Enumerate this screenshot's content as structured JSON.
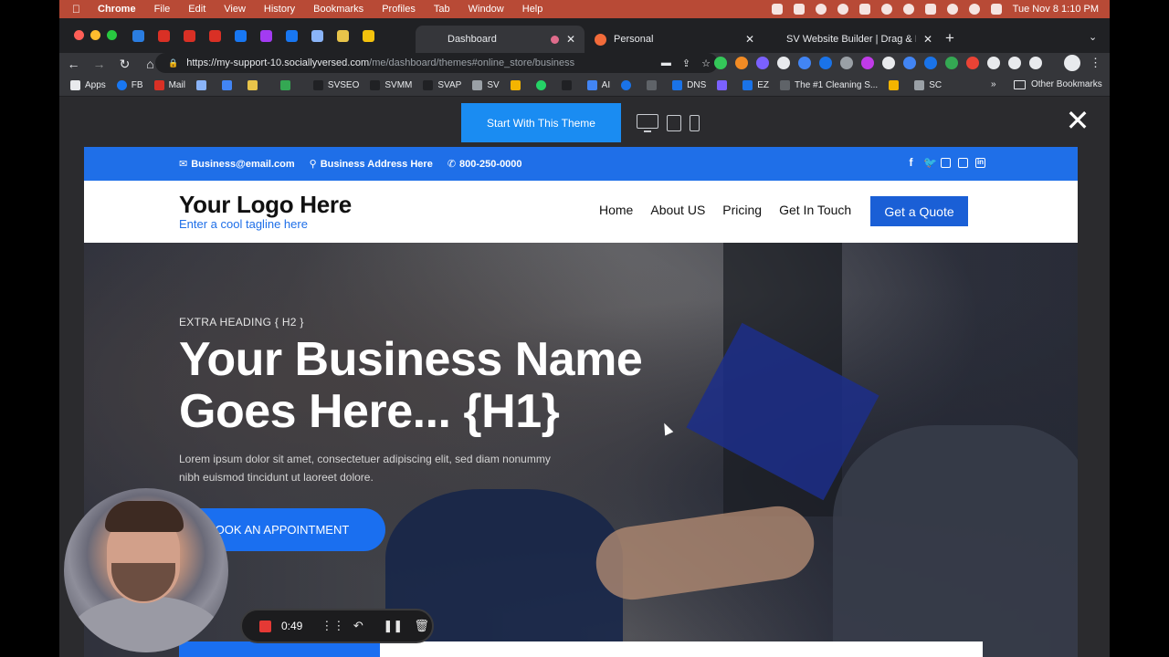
{
  "menubar": {
    "app": "Chrome",
    "items": [
      "File",
      "Edit",
      "View",
      "History",
      "Bookmarks",
      "Profiles",
      "Tab",
      "Window",
      "Help"
    ],
    "clock": "Tue Nov 8  1:10 PM"
  },
  "tabs": [
    {
      "label": "Dashboard",
      "active": true
    },
    {
      "label": "Personal",
      "active": false
    },
    {
      "label": "SV Website Builder | Drag & Dr",
      "active": false
    }
  ],
  "address": {
    "host": "https://my-support-10.sociallyversed.com",
    "path": "/me/dashboard/themes#online_store/business"
  },
  "bookmarks": [
    "Apps",
    "FB",
    "Mail",
    "SVSEO",
    "SVMM",
    "SVAP",
    "SV",
    "AI",
    "DNS",
    "EZ",
    "The #1 Cleaning S...",
    "SC"
  ],
  "bookmarks_more": "»",
  "bookmarks_other": "Other Bookmarks",
  "preview": {
    "start_button": "Start With This Theme",
    "close": "✕"
  },
  "site": {
    "email": "Business@email.com",
    "address": "Business Address Here",
    "phone": "800-250-0000",
    "logo": "Your Logo Here",
    "tagline": "Enter a cool tagline here",
    "nav": [
      "Home",
      "About US",
      "Pricing",
      "Get In Touch"
    ],
    "quote_button": "Get a Quote",
    "extra_heading": "EXTRA HEADING { H2 }",
    "headline_line1": "Your Business Name",
    "headline_line2": "Goes Here... {H1}",
    "paragraph": "Lorem ipsum dolor sit amet, consectetuer adipiscing elit, sed diam nonummy nibh euismod tincidunt ut laoreet dolore.",
    "appointment_button": "OOK AN APPOINTMENT"
  },
  "recorder": {
    "time": "0:49"
  },
  "colors": {
    "brand_blue": "#1f6fe8",
    "menubar": "#b84a36",
    "record_red": "#e53935"
  }
}
